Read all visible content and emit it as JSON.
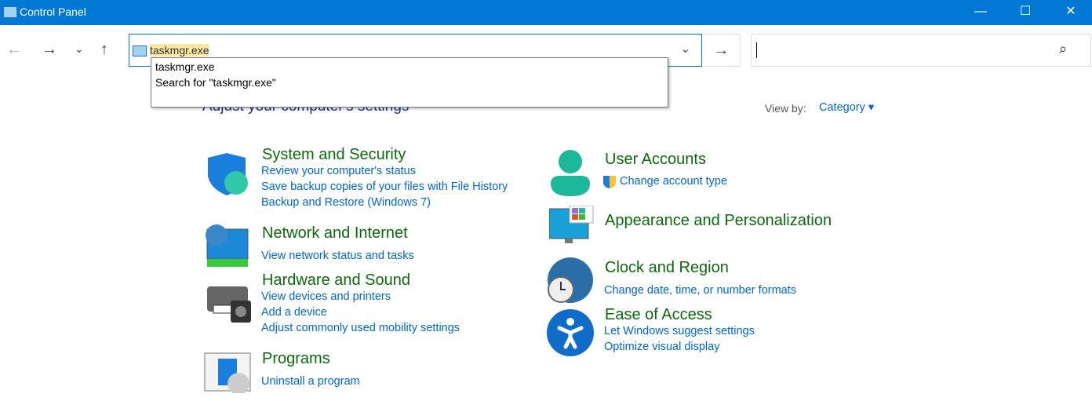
{
  "window": {
    "title": "Control Panel",
    "minimize": "—",
    "maximize": "☐",
    "close": "✕"
  },
  "nav": {
    "back": "←",
    "forward": "→",
    "recent": "⌄",
    "up": "↑"
  },
  "address": {
    "value": "taskmgr.exe",
    "go": "→",
    "dropdown_chevron": "⌄"
  },
  "autocomplete": [
    "taskmgr.exe",
    "Search for \"taskmgr.exe\""
  ],
  "search": {
    "value": "",
    "icon": "⌕"
  },
  "heading": "Adjust your computer's settings",
  "view_by": {
    "label": "View by:",
    "value": "Category"
  },
  "categories": [
    {
      "title": "System and Security",
      "links": [
        "Review your computer's status",
        "Save backup copies of your files with File History",
        "Backup and Restore (Windows 7)"
      ]
    },
    {
      "title": "Network and Internet",
      "links": [
        "View network status and tasks"
      ]
    },
    {
      "title": "Hardware and Sound",
      "links": [
        "View devices and printers",
        "Add a device",
        "Adjust commonly used mobility settings"
      ]
    },
    {
      "title": "Programs",
      "links": [
        "Uninstall a program"
      ]
    },
    {
      "title": "User Accounts",
      "links": [
        "Change account type"
      ]
    },
    {
      "title": "Appearance and Personalization",
      "links": []
    },
    {
      "title": "Clock and Region",
      "links": [
        "Change date, time, or number formats"
      ]
    },
    {
      "title": "Ease of Access",
      "links": [
        "Let Windows suggest settings",
        "Optimize visual display"
      ]
    }
  ]
}
